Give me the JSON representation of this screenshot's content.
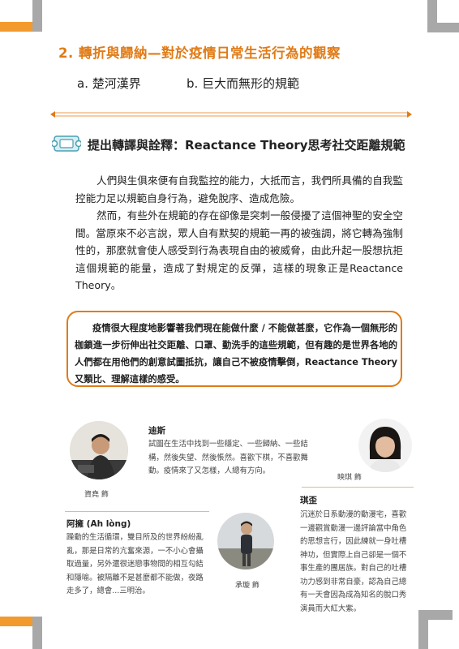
{
  "section": {
    "number_title": "2. 轉折與歸納—對於疫情日常生活行為的觀察",
    "item_a": "a. 楚河漢界",
    "item_b": "b. 巨大而無形的規範"
  },
  "topic": {
    "title": "提出轉譯與詮釋：Reactance Theory思考社交距離規範",
    "icon": "ticket-icon"
  },
  "body": {
    "paragraph1": "人們與生俱來便有自我監控的能力，大抵而言，我們所具備的自我監控能力足以規範自身行為，避免脫序、造成危險。",
    "paragraph2": "然而，有些外在規範的存在卻像是突刺一般侵擾了這個神聖的安全空間。當原來不必言說，眾人自有默契的規範一再的被強調，將它轉為強制性的，那麼就會使人感受到行為表現自由的被威脅，由此升起一股想抗拒這個規範的能量，造成了對規定的反彈，這樣的現象正是Reactance Theory。"
  },
  "quote": {
    "text": "疫情很大程度地影響著我們現在能做什麼 / 不能做甚麼，它作為一個無形的枷鎖進一步衍伸出社交距離、口罩、勤洗手的這些規範，但有趣的是世界各地的人們都在用他們的創意試圖抵抗，讓自己不被疫情擊倒，Reactance Theory又類比、理解這樣的感受。"
  },
  "characters": [
    {
      "name": "迪斯",
      "description": "試圖在生活中找到一些穩定、一些歸納、一些結構，然後失望、然後悵然。喜歡下棋，不喜歡舞動。疫情來了又怎樣，人總有方向。",
      "actor": "資堯 飾"
    },
    {
      "name": "",
      "description": "",
      "actor": "映琪 飾"
    },
    {
      "name": "琪歪",
      "description": "沉迷於日系動漫的動漫宅，喜歡一邊觀賞動漫一邊評論當中角色的思想言行，因此練就一身吐槽神功，但實際上自己卻是一個不事生產的團居族。對自己的吐槽功力感到非常自豪，認為自己總有一天會因為成為知名的脫口秀演員而大紅大紫。",
      "actor": ""
    },
    {
      "name": "阿擁 (Ah lòng)",
      "description": "躁動的生活循環，雙目所及的世界紛紛亂亂，那是日常的亢奮來源，一不小心會攝取過量，另外還很迷戀事物間的相互勾結和隱喻。被隔離不是甚麼都不能做，夜路走多了，總會...三明治。",
      "actor": "承璇 飾"
    }
  ],
  "colors": {
    "accent": "#e07b16",
    "corner_orange": "#f39a2e",
    "corner_gray": "#a8a8a8"
  }
}
